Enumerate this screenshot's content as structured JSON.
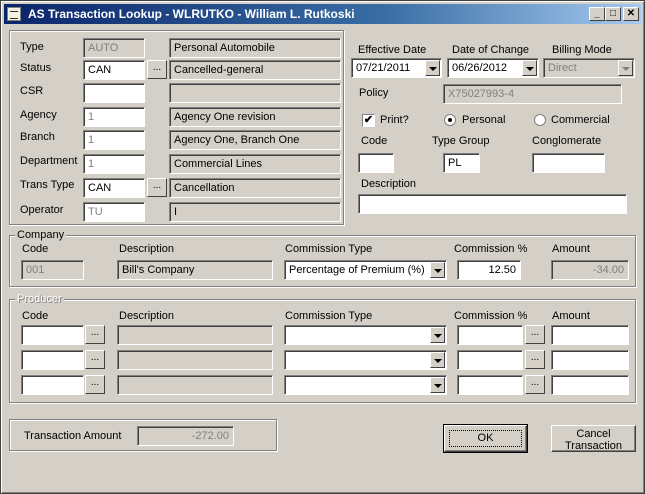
{
  "window": {
    "title": "AS Transaction Lookup - WLRUTKO - William L. Rutkoski",
    "minimize": "_",
    "maximize": "□",
    "close": "✕"
  },
  "left": {
    "type_label": "Type",
    "type_code": "AUTO",
    "type_desc": "Personal Automobile",
    "status_label": "Status",
    "status_code": "CAN",
    "status_desc": "Cancelled-general",
    "csr_label": "CSR",
    "csr_code": "",
    "csr_desc": "",
    "agency_label": "Agency",
    "agency_code": "1",
    "agency_desc": "Agency One revision",
    "branch_label": "Branch",
    "branch_code": "1",
    "branch_desc": "Agency One, Branch One",
    "department_label": "Department",
    "department_code": "1",
    "department_desc": "Commercial Lines",
    "transtype_label": "Trans Type",
    "transtype_code": "CAN",
    "transtype_desc": "Cancellation",
    "operator_label": "Operator",
    "operator_code": "TU",
    "operator_desc": "I",
    "ellipsis": "..."
  },
  "right": {
    "effective_date_label": "Effective Date",
    "effective_date": "07/21/2011",
    "date_of_change_label": "Date of Change",
    "date_of_change": "06/26/2012",
    "billing_mode_label": "Billing Mode",
    "billing_mode": "Direct",
    "policy_label": "Policy",
    "policy": "X75027993-4",
    "print_label": "Print?",
    "print_checked": "✔",
    "personal_label": "Personal",
    "commercial_label": "Commercial",
    "code_label": "Code",
    "code": "",
    "type_group_label": "Type Group",
    "type_group": "PL",
    "conglomerate_label": "Conglomerate",
    "conglomerate": "",
    "description_label": "Description",
    "description": ""
  },
  "company": {
    "legend": "Company",
    "code_label": "Code",
    "description_label": "Description",
    "commission_type_label": "Commission Type",
    "commission_pct_label": "Commission %",
    "amount_label": "Amount",
    "code": "001",
    "description": "Bill's Company",
    "commission_type": "Percentage of Premium (%)",
    "commission_pct": "12.50",
    "amount": "-34.00"
  },
  "producer": {
    "legend": "Producer",
    "code_label": "Code",
    "description_label": "Description",
    "commission_type_label": "Commission Type",
    "commission_pct_label": "Commission %",
    "amount_label": "Amount",
    "ellipsis": "..."
  },
  "footer": {
    "transaction_amount_label": "Transaction Amount",
    "transaction_amount": "-272.00",
    "ok_label": "OK",
    "cancel_line1": "Cancel",
    "cancel_line2": "Transaction"
  }
}
